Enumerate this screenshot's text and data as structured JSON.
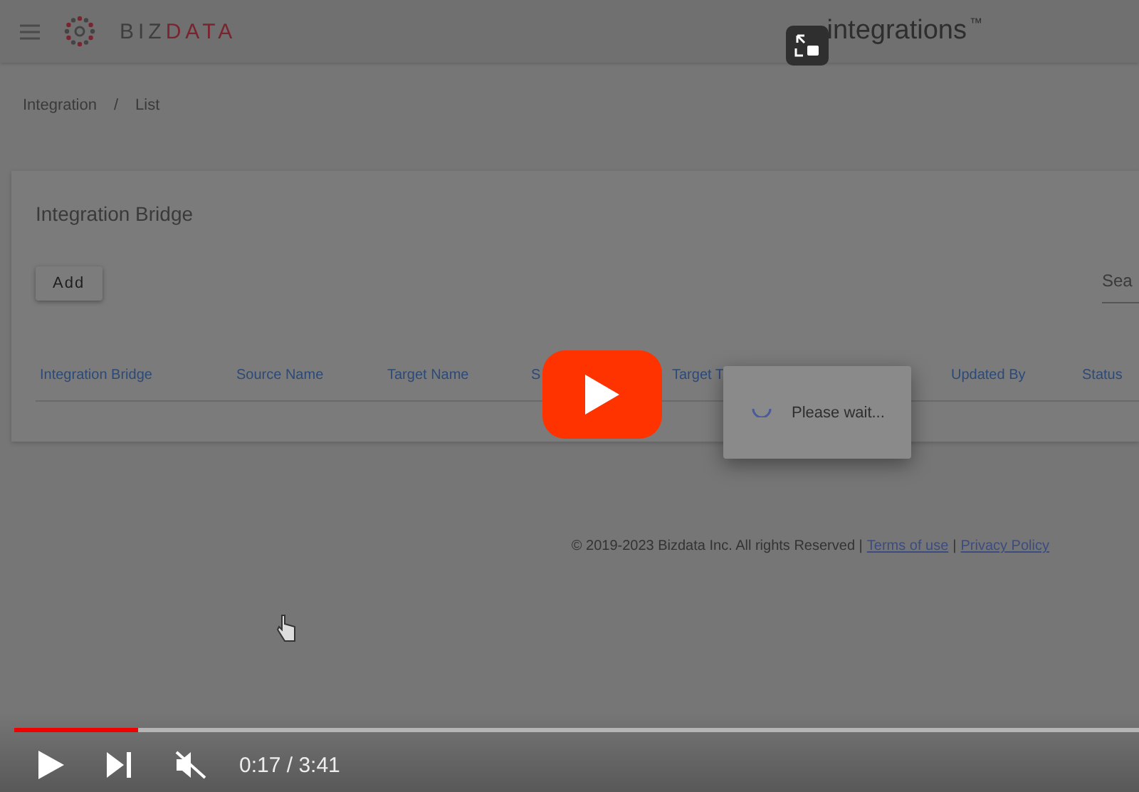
{
  "app": {
    "brand": {
      "first": "BIZ",
      "second": "DATA"
    },
    "product": {
      "name": "integrations",
      "mark": "™"
    },
    "breadcrumb": {
      "items": [
        "Integration",
        "List"
      ],
      "separator": "/"
    },
    "card": {
      "title": "Integration Bridge",
      "add_button": "Add",
      "search": {
        "placeholder": "Sea"
      },
      "columns": [
        "Integration Bridge",
        "Source Name",
        "Target Name",
        "S",
        "Target T",
        null,
        "Updated By",
        "Status"
      ]
    },
    "dialog": {
      "message": "Please wait..."
    },
    "footer": {
      "copyright": "© 2019-2023 Bizdata Inc. All rights Reserved |",
      "terms": "Terms of use",
      "divider": "|",
      "privacy": "Privacy Policy"
    }
  },
  "player": {
    "level": 0.11,
    "time": "0:17 / 3:41",
    "muted": true
  }
}
